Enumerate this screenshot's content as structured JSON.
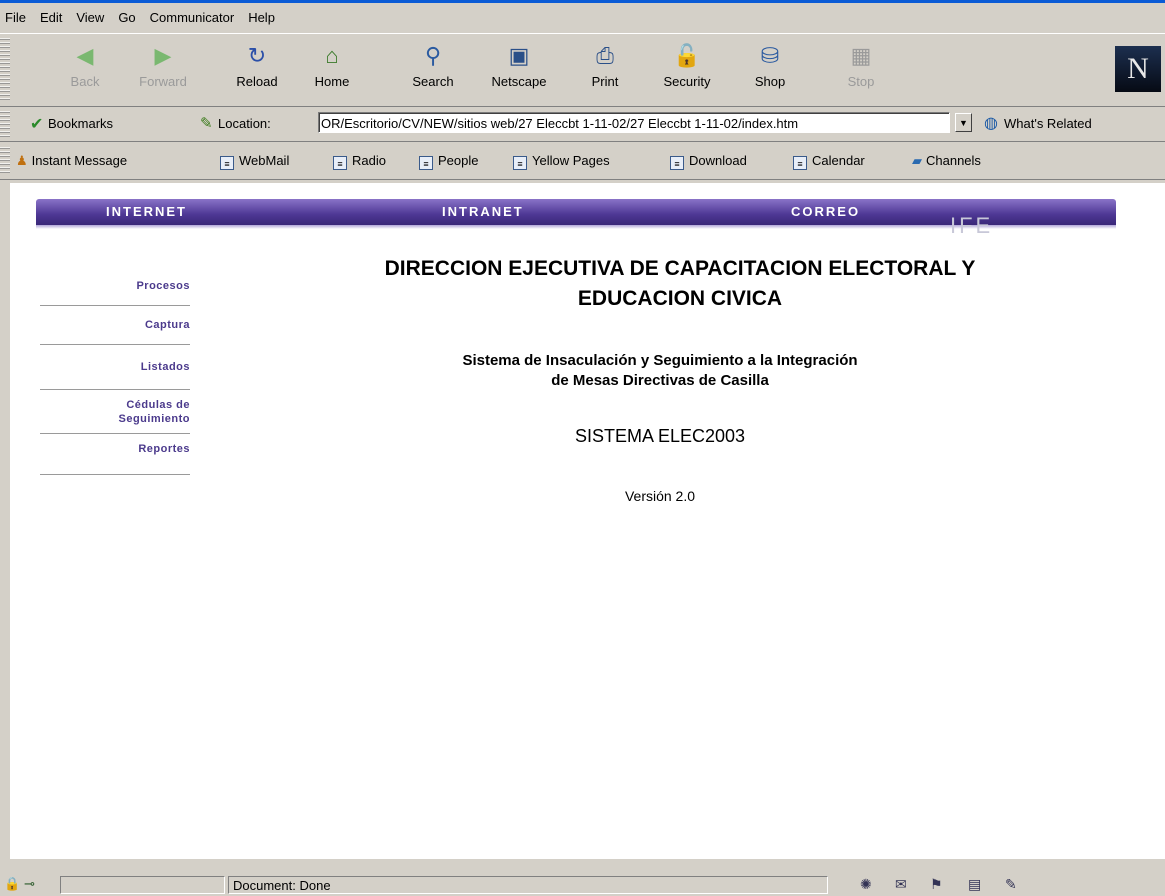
{
  "menu": [
    "File",
    "Edit",
    "View",
    "Go",
    "Communicator",
    "Help"
  ],
  "toolbar": [
    {
      "label": "Back",
      "icon": "back-arrow-icon",
      "glyph": "◀",
      "disabled": true
    },
    {
      "label": "Forward",
      "icon": "forward-arrow-icon",
      "glyph": "▶",
      "disabled": true
    },
    {
      "label": "Reload",
      "icon": "reload-icon",
      "glyph": "↻",
      "disabled": false
    },
    {
      "label": "Home",
      "icon": "home-icon",
      "glyph": "⌂",
      "disabled": false
    },
    {
      "label": "Search",
      "icon": "search-icon",
      "glyph": "⚲",
      "disabled": false
    },
    {
      "label": "Netscape",
      "icon": "netscape-my-icon",
      "glyph": "▣",
      "disabled": false
    },
    {
      "label": "Print",
      "icon": "print-icon",
      "glyph": "⎙",
      "disabled": false
    },
    {
      "label": "Security",
      "icon": "lock-icon",
      "glyph": "🔓",
      "disabled": false
    },
    {
      "label": "Shop",
      "icon": "shop-bag-icon",
      "glyph": "⛁",
      "disabled": false
    },
    {
      "label": "Stop",
      "icon": "stop-icon",
      "glyph": "▦",
      "disabled": true
    }
  ],
  "logo_letter": "N",
  "location": {
    "bookmarks_label": "Bookmarks",
    "label": "Location:",
    "url": "OR/Escritorio/CV/NEW/sitios web/27 Eleccbt 1-11-02/27 Eleccbt 1-11-02/index.htm",
    "related_label": "What's Related"
  },
  "personal": [
    "Instant Message",
    "WebMail",
    "Radio",
    "People",
    "Yellow Pages",
    "Download",
    "Calendar",
    "Channels"
  ],
  "page": {
    "tabs": [
      "INTERNET",
      "INTRANET",
      "CORREO"
    ],
    "brand": "IFE",
    "nav": [
      "Procesos",
      "Captura",
      "Listados",
      "Cédulas de Seguimiento",
      "Reportes"
    ],
    "title_line1": "DIRECCION EJECUTIVA DE CAPACITACION ELECTORAL Y",
    "title_line2": "EDUCACION CIVICA",
    "subtitle_line1": "Sistema de Insaculación y Seguimiento a la Integración",
    "subtitle_line2": "de Mesas Directivas de Casilla",
    "system": "SISTEMA ELEC2003",
    "version": "Versión 2.0"
  },
  "status": {
    "text": "Document: Done"
  },
  "colors": {
    "accent_blue": "#0a5bd6",
    "banner_purple": "#4d3794",
    "nav_text": "#4b3a8c"
  }
}
